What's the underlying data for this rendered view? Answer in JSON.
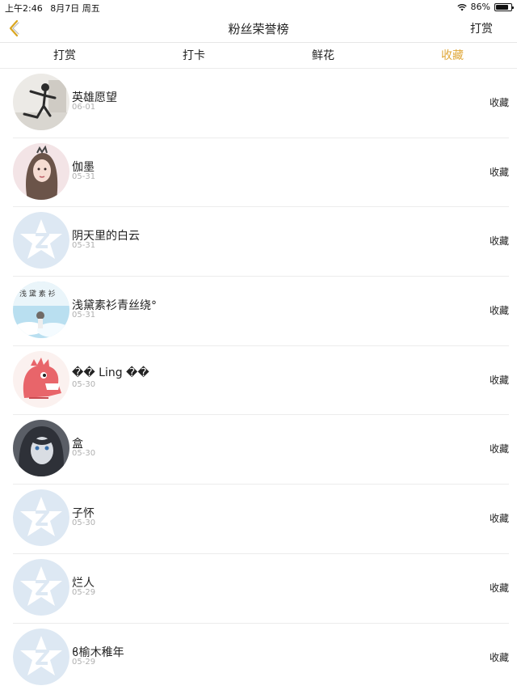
{
  "status_bar": {
    "time": "上午2:46",
    "date": "8月7日 周五",
    "battery": "86%",
    "battery_level": 0.86
  },
  "nav": {
    "title": "粉丝荣誉榜",
    "action": "打赏"
  },
  "tabs": [
    {
      "label": "打赏",
      "active": false
    },
    {
      "label": "打卡",
      "active": false
    },
    {
      "label": "鲜花",
      "active": false
    },
    {
      "label": "收藏",
      "active": true
    }
  ],
  "colors": {
    "accent": "#e0a83a",
    "placeholder_avatar": "#dde8f3"
  },
  "list": [
    {
      "name": "英雄愿望",
      "date": "06-01",
      "action": "收藏",
      "avatar": "photo-dancer"
    },
    {
      "name": "伽墨",
      "date": "05-31",
      "action": "收藏",
      "avatar": "illustration-girl"
    },
    {
      "name": "阴天里的白云",
      "date": "05-31",
      "action": "收藏",
      "avatar": "default-qq-icon"
    },
    {
      "name": "浅黛素衫青丝绕°",
      "date": "05-31",
      "action": "收藏",
      "avatar": "photo-sky"
    },
    {
      "name": "�� Ling ��",
      "date": "05-30",
      "action": "收藏",
      "avatar": "cartoon-dinosaur"
    },
    {
      "name": "盒",
      "date": "05-30",
      "action": "收藏",
      "avatar": "illustration-dark"
    },
    {
      "name": "子怀",
      "date": "05-30",
      "action": "收藏",
      "avatar": "default-qq-icon"
    },
    {
      "name": "烂人",
      "date": "05-29",
      "action": "收藏",
      "avatar": "default-qq-icon"
    },
    {
      "name": "ϐ榆木稚年",
      "date": "05-29",
      "action": "收藏",
      "avatar": "default-qq-icon"
    }
  ]
}
